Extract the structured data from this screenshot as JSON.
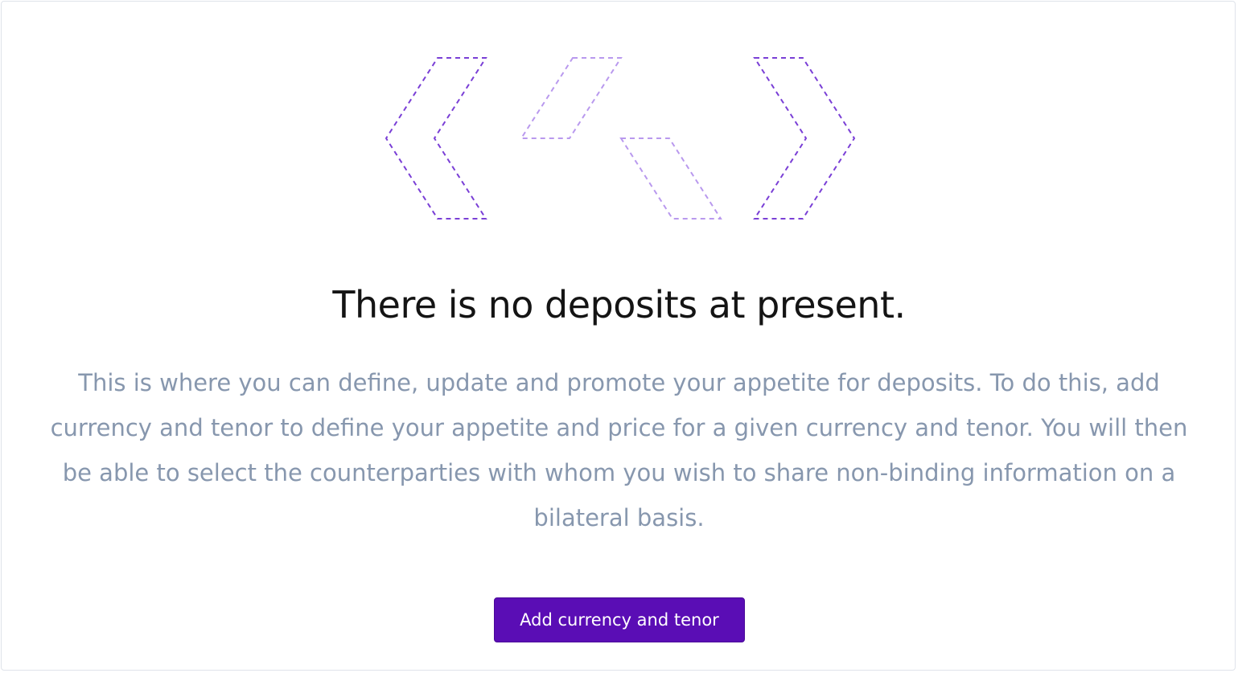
{
  "empty_state": {
    "illustration_icon": "empty-deposits-icon",
    "title": "There is no deposits at present.",
    "description": "This is where you can define, update and promote your appetite for deposits. To do this, add currency and tenor to define your appetite and price for a given currency and tenor. You will then be able to select the counterparties with whom you wish to share non-binding information on a bilateral basis.",
    "button_label": "Add currency and tenor"
  },
  "colors": {
    "accent": "#5a0db5",
    "illustration_dark": "#7a3fd6",
    "illustration_light": "#b999ee",
    "title_text": "#141414",
    "body_text": "#8797ae",
    "border": "#dfe3ea"
  }
}
